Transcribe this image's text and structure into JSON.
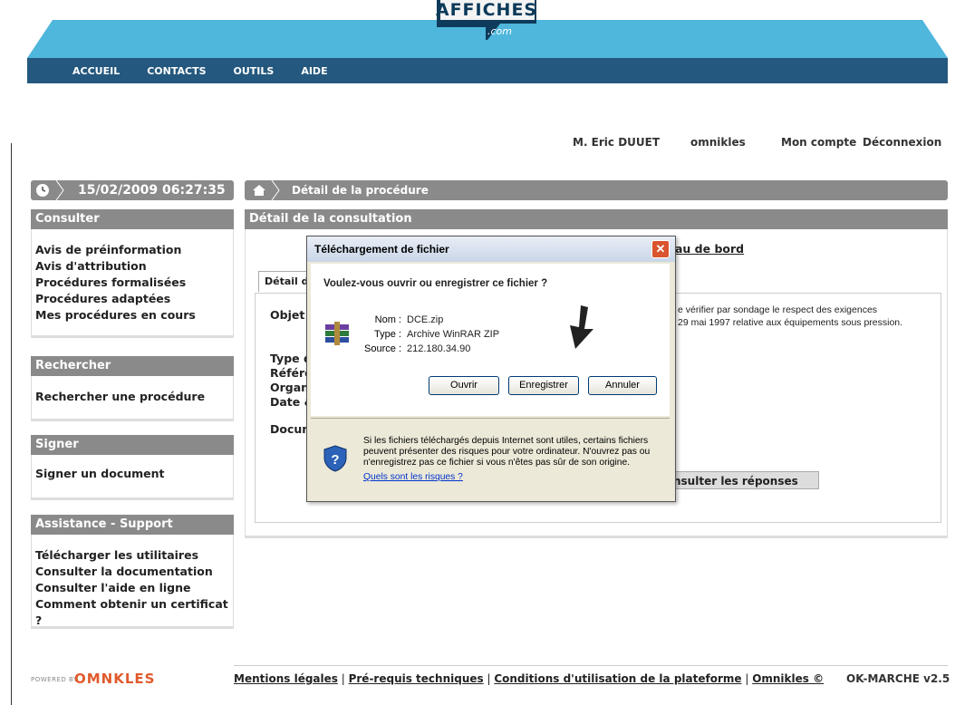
{
  "brand": {
    "logo_main": "AFFICHES",
    "logo_sub": ".com"
  },
  "nav": [
    "ACCUEIL",
    "CONTACTS",
    "OUTILS",
    "AIDE"
  ],
  "user_bar": {
    "user": "M. Eric DUUET",
    "org": "omnikles",
    "account": "Mon compte",
    "logout": "Déconnexion"
  },
  "datetime": "15/02/2009 06:27:35",
  "breadcrumb": "Détail de la procédure",
  "sidebar": {
    "consulter": {
      "title": "Consulter",
      "items": [
        "Avis de préinformation",
        "Avis d'attribution",
        "Procédures formalisées",
        "Procédures adaptées",
        "Mes procédures en cours"
      ]
    },
    "rechercher": {
      "title": "Rechercher",
      "items": [
        "Rechercher une procédure"
      ]
    },
    "signer": {
      "title": "Signer",
      "items": [
        "Signer un document"
      ]
    },
    "assistance": {
      "title": "Assistance - Support",
      "items": [
        "Télécharger les utilitaires",
        "Consulter la documentation",
        "Consulter l'aide en ligne",
        "Comment obtenir un certificat ?"
      ]
    }
  },
  "main": {
    "section_title": "Détail de la consultation",
    "dashboard_link": "au de bord",
    "tab_label": "Détail d",
    "labels": [
      "Objet d",
      "Type d",
      "Référe",
      "Organi",
      "Date &",
      "Docum"
    ],
    "objet_line1": "e vérifier par sondage le respect des exigences",
    "objet_line2": "29 mai 1997 relative aux équipements sous pression.",
    "responses_button": "nsulter les réponses"
  },
  "dialog": {
    "title": "Téléchargement de fichier",
    "question": "Voulez-vous ouvrir ou enregistrer ce fichier ?",
    "name_label": "Nom :",
    "name_value": "DCE.zip",
    "type_label": "Type :",
    "type_value": "Archive WinRAR ZIP",
    "source_label": "Source :",
    "source_value": "212.180.34.90",
    "btn_open": "Ouvrir",
    "btn_save": "Enregistrer",
    "btn_cancel": "Annuler",
    "warning": "Si les fichiers téléchargés depuis Internet sont utiles, certains fichiers peuvent présenter des risques pour votre ordinateur. N'ouvrez pas ou n'enregistrez pas ce fichier si vous n'êtes pas sûr de son origine.",
    "risk_link": "Quels sont les risques ?"
  },
  "footer": {
    "powered_by": "POWERED BY",
    "brand": "OMNKLES",
    "links": [
      "Mentions légales",
      "Pré-requis techniques",
      "Conditions d'utilisation de la plateforme",
      "Omnikles ©"
    ],
    "version": "OK-MARCHE v2.5"
  },
  "colors": {
    "header_teal": "#4fb6dc",
    "nav_blue": "#24587e",
    "panel_gray": "#8a8a8a"
  }
}
